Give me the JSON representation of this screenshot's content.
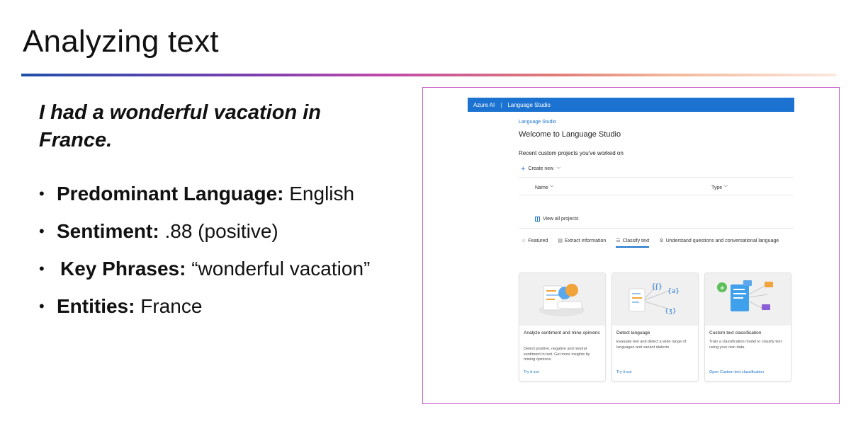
{
  "slide": {
    "title": "Analyzing text",
    "quote": "I had a wonderful vacation in France.",
    "bullets": [
      {
        "label": "Predominant Language:",
        "value": "English"
      },
      {
        "label": "Sentiment:",
        "value": ".88 (positive)"
      },
      {
        "label": "Key Phrases:",
        "value": "“wonderful vacation”"
      },
      {
        "label": "Entities:",
        "value": "France"
      }
    ]
  },
  "studio": {
    "brand": "Azure AI",
    "product": "Language Studio",
    "breadcrumb": "Language Studio",
    "welcome": "Welcome to Language Studio",
    "recent_heading": "Recent custom projects you've worked on",
    "create_new": "Create new",
    "columns": [
      "Name",
      "Type"
    ],
    "view_all": "View all projects",
    "tabs": [
      {
        "label": "Featured",
        "icon": "star-icon",
        "active": false
      },
      {
        "label": "Extract information",
        "icon": "document-icon",
        "active": false
      },
      {
        "label": "Classify text",
        "icon": "list-icon",
        "active": true
      },
      {
        "label": "Understand questions and conversational language",
        "icon": "gear-icon",
        "active": false
      }
    ],
    "cards": [
      {
        "title": "Analyze sentiment and mine opinions",
        "desc": "Detect positive, negative and neutral sentiment in text. Get more insights by mining opinions.",
        "link": "Try it out"
      },
      {
        "title": "Detect language",
        "desc": "Evaluate text and detect a wide range of languages and variant dialects.",
        "link": "Try it out"
      },
      {
        "title": "Custom text classification",
        "desc": "Train a classification model to classify text using your own data.",
        "link": "Open Custom text classification"
      }
    ]
  },
  "colors": {
    "accent": "#1c72d0",
    "frame": "#c75fc9"
  }
}
